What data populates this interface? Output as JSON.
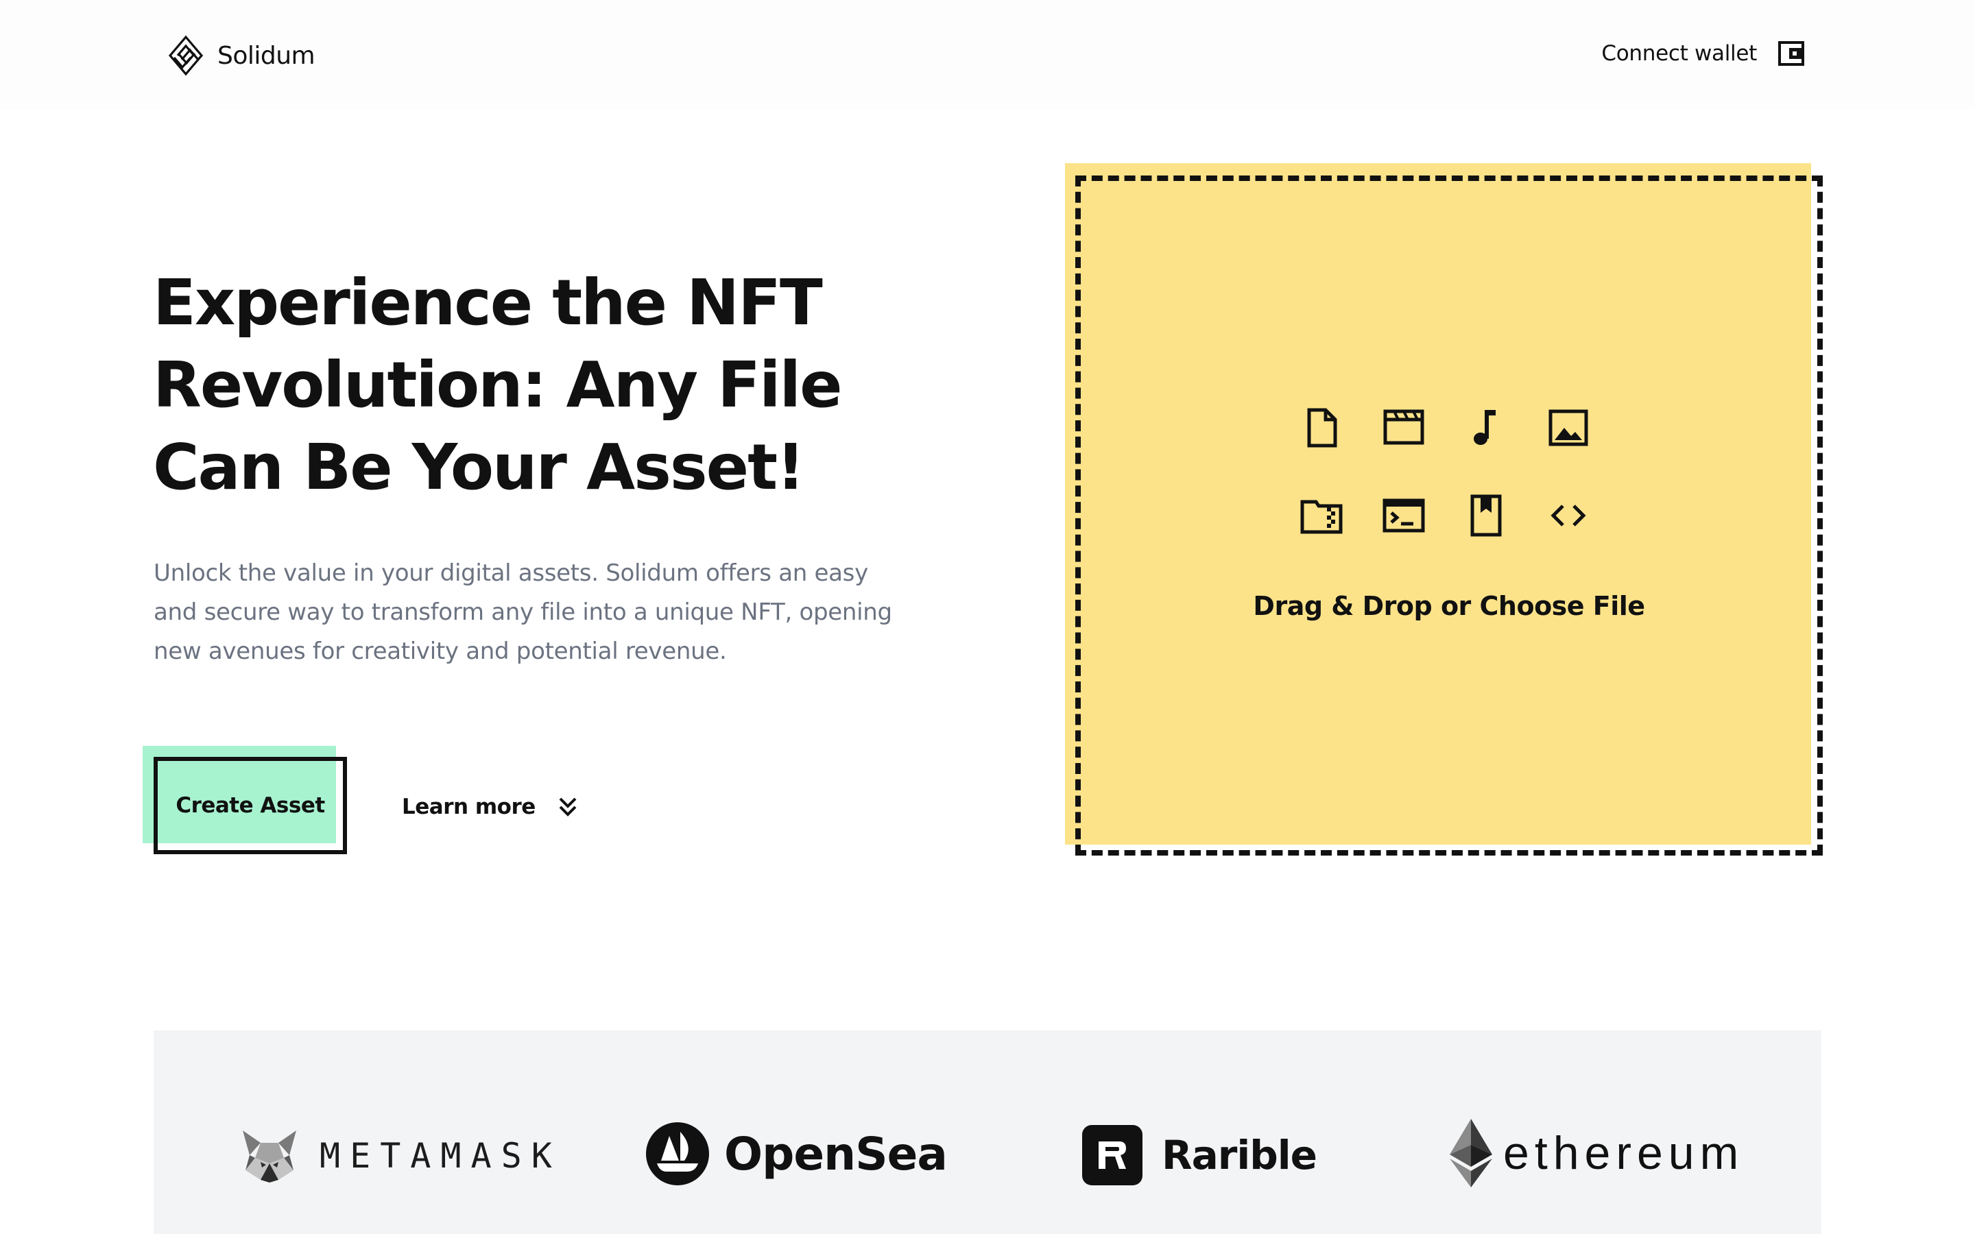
{
  "header": {
    "brand": "Solidum",
    "connect_label": "Connect wallet"
  },
  "hero": {
    "title": "Experience the NFT Revolution: Any File Can Be Your Asset!",
    "description": "Unlock the value in your digital assets. Solidum offers an easy and secure way to transform any file into a unique NFT, opening new avenues for creativity and potential revenue.",
    "create_label": "Create Asset",
    "learn_label": "Learn more"
  },
  "dropzone": {
    "label": "Drag & Drop or Choose File",
    "icons": [
      "document-icon",
      "video-icon",
      "music-icon",
      "image-icon",
      "archive-icon",
      "terminal-icon",
      "bookmark-icon",
      "code-icon"
    ]
  },
  "partners": {
    "metamask": "METAMASK",
    "opensea": "OpenSea",
    "rarible": "Rarible",
    "ethereum": "ethereum"
  },
  "colors": {
    "accent_green": "#a7f3d0",
    "dropzone_yellow": "#fce38a",
    "text_muted": "#6b7280",
    "partners_bg": "#f3f4f6"
  }
}
